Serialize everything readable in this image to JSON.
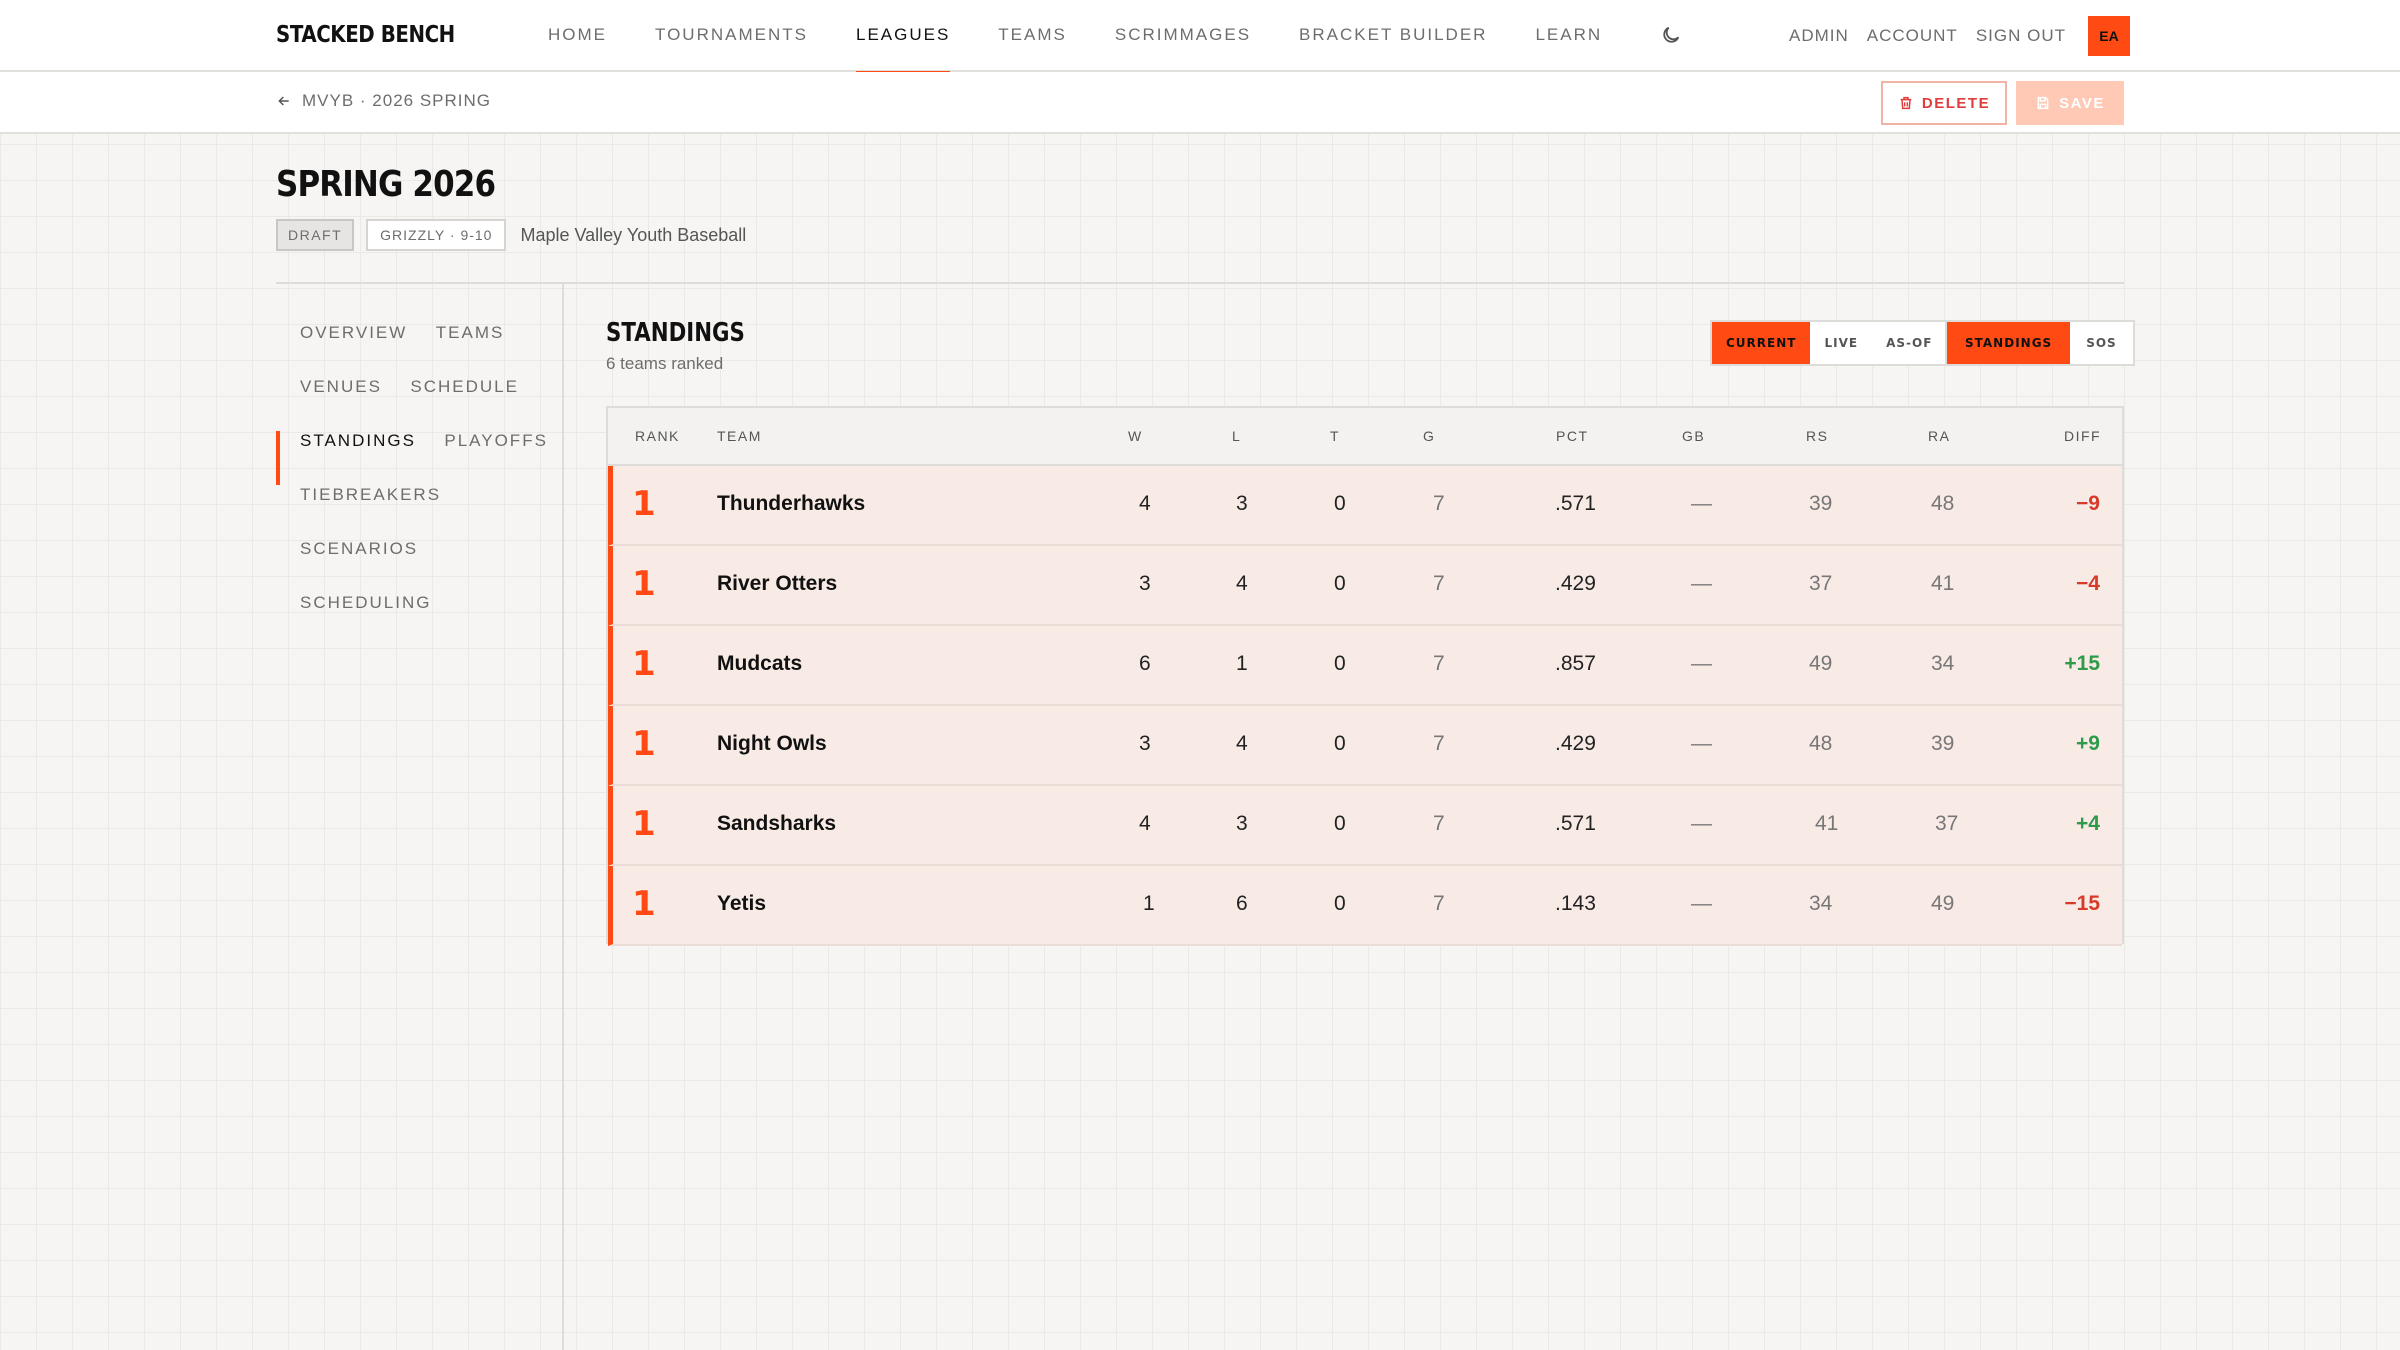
{
  "brand": "STACKED BENCH",
  "nav": {
    "links": [
      "HOME",
      "TOURNAMENTS",
      "LEAGUES",
      "TEAMS",
      "SCRIMMAGES",
      "BRACKET BUILDER",
      "LEARN"
    ],
    "active": "LEAGUES",
    "right": [
      "ADMIN",
      "ACCOUNT",
      "SIGN OUT"
    ],
    "avatar": "EA"
  },
  "subbar": {
    "breadcrumb": "MVYB · 2026 SPRING",
    "delete_label": "DELETE",
    "save_label": "SAVE"
  },
  "page": {
    "title": "SPRING 2026",
    "status": "DRAFT",
    "division": "GRIZZLY · 9-10",
    "organization": "Maple Valley Youth Baseball"
  },
  "sidebar": {
    "items": [
      "OVERVIEW",
      "TEAMS",
      "VENUES",
      "SCHEDULE",
      "STANDINGS",
      "PLAYOFFS",
      "TIEBREAKERS",
      "SCENARIOS",
      "SCHEDULING"
    ],
    "active": "STANDINGS"
  },
  "standings": {
    "title": "STANDINGS",
    "subtitle": "6 teams ranked",
    "mode_options": [
      "CURRENT",
      "LIVE",
      "AS-OF"
    ],
    "mode_active": "CURRENT",
    "view_options": [
      "STANDINGS",
      "SOS"
    ],
    "view_active": "STANDINGS",
    "columns": [
      "RANK",
      "TEAM",
      "W",
      "L",
      "T",
      "G",
      "PCT",
      "GB",
      "RS",
      "RA",
      "DIFF"
    ],
    "rows": [
      {
        "rank": "1",
        "team": "Thunderhawks",
        "w": "4",
        "l": "3",
        "t": "0",
        "g": "7",
        "pct": ".571",
        "gb": "—",
        "rs": "39",
        "ra": "48",
        "diff": "−9"
      },
      {
        "rank": "1",
        "team": "River Otters",
        "w": "3",
        "l": "4",
        "t": "0",
        "g": "7",
        "pct": ".429",
        "gb": "—",
        "rs": "37",
        "ra": "41",
        "diff": "−4"
      },
      {
        "rank": "1",
        "team": "Mudcats",
        "w": "6",
        "l": "1",
        "t": "0",
        "g": "7",
        "pct": ".857",
        "gb": "—",
        "rs": "49",
        "ra": "34",
        "diff": "+15"
      },
      {
        "rank": "1",
        "team": "Night Owls",
        "w": "3",
        "l": "4",
        "t": "0",
        "g": "7",
        "pct": ".429",
        "gb": "—",
        "rs": "48",
        "ra": "39",
        "diff": "+9"
      },
      {
        "rank": "1",
        "team": "Sandsharks",
        "w": "4",
        "l": "3",
        "t": "0",
        "g": "7",
        "pct": ".571",
        "gb": "—",
        "rs": "41",
        "ra": "37",
        "diff": "+4"
      },
      {
        "rank": "1",
        "team": "Yetis",
        "w": "1",
        "l": "6",
        "t": "0",
        "g": "7",
        "pct": ".143",
        "gb": "—",
        "rs": "34",
        "ra": "49",
        "diff": "−15"
      }
    ]
  },
  "colors": {
    "accent": "#ff4a14",
    "negative": "#d83a2a",
    "positive": "#2e9a4a"
  },
  "icons": {
    "theme_toggle": "moon-icon",
    "back": "arrow-left-icon",
    "delete": "trash-icon",
    "save": "save-icon"
  }
}
